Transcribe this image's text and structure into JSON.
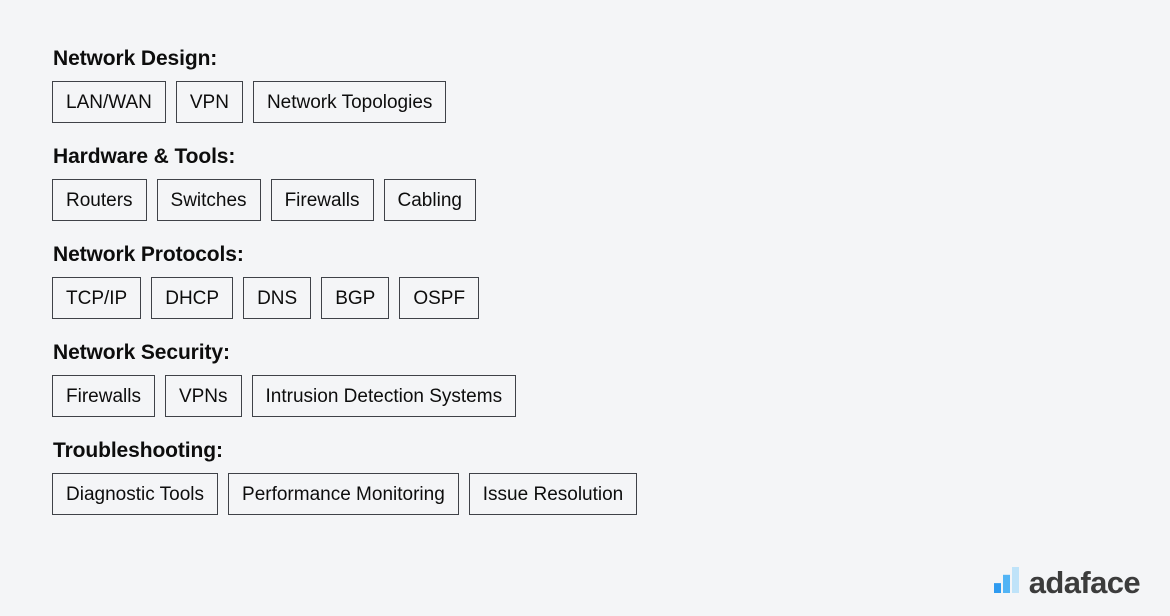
{
  "page": {
    "background_color": "#f4f5f7",
    "text_color": "#0d0d0d",
    "chip_border_color": "#3f4248"
  },
  "sections": [
    {
      "heading": "Network Design:",
      "chips": [
        "LAN/WAN",
        "VPN",
        "Network Topologies"
      ]
    },
    {
      "heading": "Hardware & Tools:",
      "chips": [
        "Routers",
        "Switches",
        "Firewalls",
        "Cabling"
      ]
    },
    {
      "heading": "Network Protocols:",
      "chips": [
        "TCP/IP",
        "DHCP",
        "DNS",
        "BGP",
        "OSPF"
      ]
    },
    {
      "heading": "Network Security:",
      "chips": [
        "Firewalls",
        "VPNs",
        "Intrusion Detection Systems"
      ]
    },
    {
      "heading": "Troubleshooting:",
      "chips": [
        "Diagnostic Tools",
        "Performance Monitoring",
        "Issue Resolution"
      ]
    }
  ],
  "brand": {
    "name": "adaface",
    "name_color": "#3c3c3c",
    "logo_icon": "bar-chart-icon",
    "logo_bars": [
      {
        "color": "#2f9bf0",
        "height_pct": 38
      },
      {
        "color": "#52b4f5",
        "height_pct": 70
      },
      {
        "color": "#bfe3f9",
        "height_pct": 100
      }
    ]
  }
}
